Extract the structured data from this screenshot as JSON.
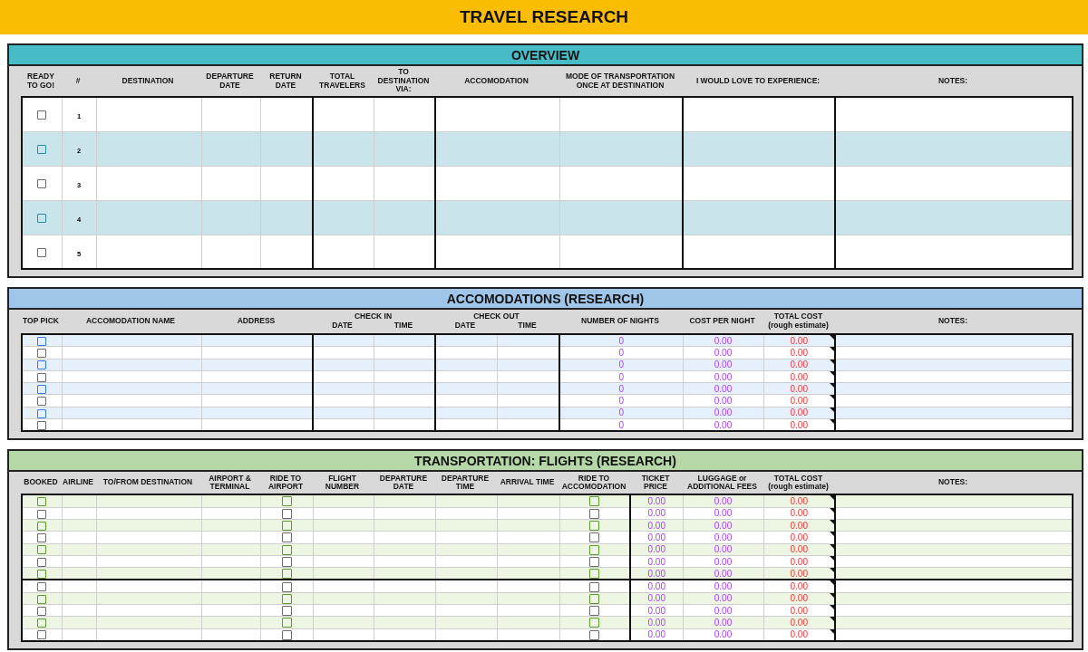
{
  "title": "TRAVEL RESEARCH",
  "overview": {
    "title": "OVERVIEW",
    "columns": [
      {
        "label": "READY TO GO!"
      },
      {
        "label": "#"
      },
      {
        "label": "DESTINATION"
      },
      {
        "label": "DEPARTURE DATE"
      },
      {
        "label": "RETURN DATE"
      },
      {
        "label": "TOTAL TRAVELERS"
      },
      {
        "label": "TO DESTINATION VIA:"
      },
      {
        "label": "ACCOMODATION"
      },
      {
        "label": "MODE OF TRANSPORTATION ONCE AT DESTINATION"
      },
      {
        "label": "I WOULD LOVE TO EXPERIENCE:"
      },
      {
        "label": "NOTES:"
      }
    ],
    "rows": [
      {
        "checked": false,
        "number": "1"
      },
      {
        "checked": false,
        "number": "2"
      },
      {
        "checked": false,
        "number": "3"
      },
      {
        "checked": false,
        "number": "4"
      },
      {
        "checked": false,
        "number": "5"
      }
    ]
  },
  "accommodations": {
    "title": "ACCOMODATIONS (RESEARCH)",
    "columns": [
      {
        "label": "TOP PICK"
      },
      {
        "label": "ACCOMODATION NAME"
      },
      {
        "label": "ADDRESS"
      },
      {
        "label": "CHECK IN",
        "sub": [
          "DATE",
          "TIME"
        ]
      },
      {
        "label": "CHECK OUT",
        "sub": [
          "DATE",
          "TIME"
        ]
      },
      {
        "label": "NUMBER OF NIGHTS"
      },
      {
        "label": "COST PER NIGHT"
      },
      {
        "label": "TOTAL COST",
        "note": "(rough estimate)"
      },
      {
        "label": "NOTES:"
      }
    ],
    "rows": [
      {
        "top_pick": false,
        "nights": "0",
        "cost_per_night": "0.00",
        "total_cost": "0.00"
      },
      {
        "top_pick": false,
        "nights": "0",
        "cost_per_night": "0.00",
        "total_cost": "0.00"
      },
      {
        "top_pick": false,
        "nights": "0",
        "cost_per_night": "0.00",
        "total_cost": "0.00"
      },
      {
        "top_pick": false,
        "nights": "0",
        "cost_per_night": "0.00",
        "total_cost": "0.00"
      },
      {
        "top_pick": false,
        "nights": "0",
        "cost_per_night": "0.00",
        "total_cost": "0.00"
      },
      {
        "top_pick": false,
        "nights": "0",
        "cost_per_night": "0.00",
        "total_cost": "0.00"
      },
      {
        "top_pick": false,
        "nights": "0",
        "cost_per_night": "0.00",
        "total_cost": "0.00"
      },
      {
        "top_pick": false,
        "nights": "0",
        "cost_per_night": "0.00",
        "total_cost": "0.00"
      }
    ]
  },
  "flights": {
    "title": "TRANSPORTATION: FLIGHTS (RESEARCH)",
    "columns": [
      {
        "label": "BOOKED"
      },
      {
        "label": "AIRLINE"
      },
      {
        "label": "TO/FROM DESTINATION"
      },
      {
        "label": "AIRPORT & TERMINAL"
      },
      {
        "label": "RIDE TO AIRPORT"
      },
      {
        "label": "FLIGHT NUMBER"
      },
      {
        "label": "DEPARTURE DATE"
      },
      {
        "label": "DEPARTURE TIME"
      },
      {
        "label": "ARRIVAL TIME"
      },
      {
        "label": "RIDE TO ACCOMODATION"
      },
      {
        "label": "TICKET PRICE"
      },
      {
        "label": "LUGGAGE or ADDITIONAL FEES"
      },
      {
        "label": "TOTAL COST",
        "note": "(rough estimate)"
      },
      {
        "label": "NOTES:"
      }
    ],
    "rows": [
      {
        "booked": false,
        "ride_to_airport": false,
        "ride_to_accomodation": false,
        "ticket_price": "0.00",
        "luggage_fees": "0.00",
        "total_cost": "0.00"
      },
      {
        "booked": false,
        "ride_to_airport": false,
        "ride_to_accomodation": false,
        "ticket_price": "0.00",
        "luggage_fees": "0.00",
        "total_cost": "0.00"
      },
      {
        "booked": false,
        "ride_to_airport": false,
        "ride_to_accomodation": false,
        "ticket_price": "0.00",
        "luggage_fees": "0.00",
        "total_cost": "0.00"
      },
      {
        "booked": false,
        "ride_to_airport": false,
        "ride_to_accomodation": false,
        "ticket_price": "0.00",
        "luggage_fees": "0.00",
        "total_cost": "0.00"
      },
      {
        "booked": false,
        "ride_to_airport": false,
        "ride_to_accomodation": false,
        "ticket_price": "0.00",
        "luggage_fees": "0.00",
        "total_cost": "0.00"
      },
      {
        "booked": false,
        "ride_to_airport": false,
        "ride_to_accomodation": false,
        "ticket_price": "0.00",
        "luggage_fees": "0.00",
        "total_cost": "0.00"
      },
      {
        "booked": false,
        "ride_to_airport": false,
        "ride_to_accomodation": false,
        "ticket_price": "0.00",
        "luggage_fees": "0.00",
        "total_cost": "0.00"
      },
      {
        "booked": false,
        "ride_to_airport": false,
        "ride_to_accomodation": false,
        "ticket_price": "0.00",
        "luggage_fees": "0.00",
        "total_cost": "0.00"
      },
      {
        "booked": false,
        "ride_to_airport": false,
        "ride_to_accomodation": false,
        "ticket_price": "0.00",
        "luggage_fees": "0.00",
        "total_cost": "0.00"
      },
      {
        "booked": false,
        "ride_to_airport": false,
        "ride_to_accomodation": false,
        "ticket_price": "0.00",
        "luggage_fees": "0.00",
        "total_cost": "0.00"
      },
      {
        "booked": false,
        "ride_to_airport": false,
        "ride_to_accomodation": false,
        "ticket_price": "0.00",
        "luggage_fees": "0.00",
        "total_cost": "0.00"
      },
      {
        "booked": false,
        "ride_to_airport": false,
        "ride_to_accomodation": false,
        "ticket_price": "0.00",
        "luggage_fees": "0.00",
        "total_cost": "0.00"
      }
    ]
  }
}
